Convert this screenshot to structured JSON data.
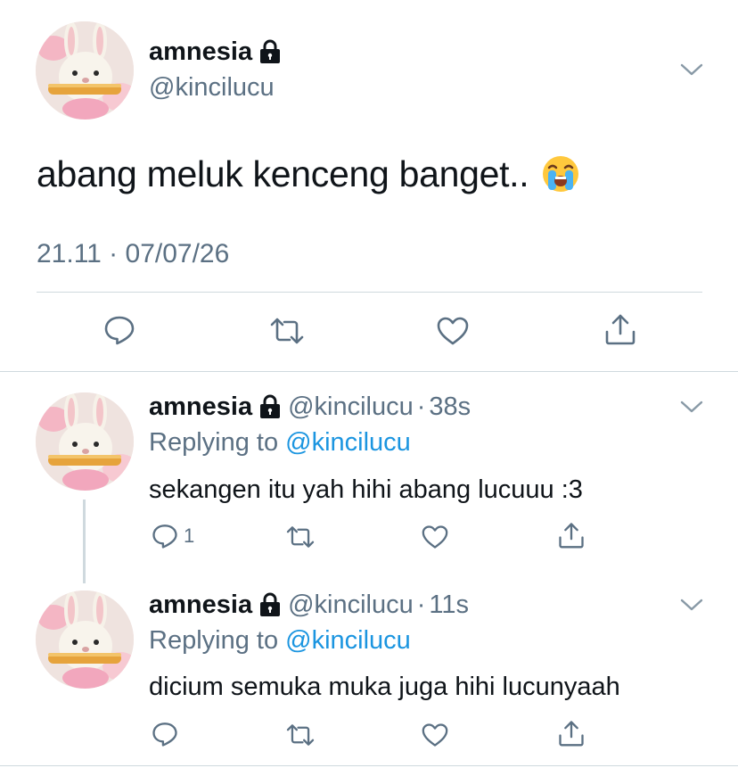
{
  "main_tweet": {
    "display_name": "amnesia",
    "handle": "@kincilucu",
    "text": "abang meluk kenceng banget..",
    "emoji": "loudly-crying-face-emoji",
    "timestamp": "21.11 · 07/07/26",
    "actions": [
      "reply-icon",
      "retweet-icon",
      "like-icon",
      "share-icon"
    ]
  },
  "replies": [
    {
      "display_name": "amnesia",
      "handle": "@kincilucu",
      "dot": "·",
      "time": "38s",
      "replying_prefix": "Replying to",
      "replying_handle": "@kincilucu",
      "text": "sekangen itu yah hihi abang lucuuu :3",
      "reply_count": "1"
    },
    {
      "display_name": "amnesia",
      "handle": "@kincilucu",
      "dot": "·",
      "time": "11s",
      "replying_prefix": "Replying to",
      "replying_handle": "@kincilucu",
      "text": "dicium semuka muka juga hihi lucunyaah",
      "reply_count": ""
    }
  ],
  "colors": {
    "text": "#0f1419",
    "secondary": "#5b7083",
    "link": "#1b95e0",
    "divider": "#cfd9de"
  }
}
